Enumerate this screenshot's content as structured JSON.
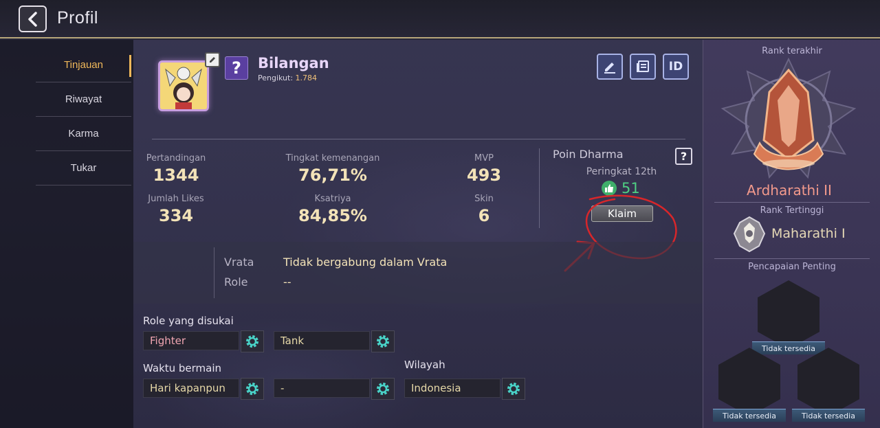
{
  "header": {
    "title": "Profil",
    "back_icon": "chevron-left-icon"
  },
  "nav": {
    "items": [
      "Tinjauan",
      "Riwayat",
      "Karma",
      "Tukar"
    ],
    "active": "Tinjauan"
  },
  "profile": {
    "username": "Bilangan",
    "followers_label": "Pengikut:",
    "followers_value": "1.784",
    "badge": "?",
    "actions": [
      "edit-icon",
      "news-icon",
      "id-icon"
    ],
    "id_label": "ID"
  },
  "stats": {
    "matches_label": "Pertandingan",
    "matches_value": "1344",
    "winrate_label": "Tingkat kemenangan",
    "winrate_value": "76,71%",
    "mvp_label": "MVP",
    "mvp_value": "493",
    "likes_label": "Jumlah Likes",
    "likes_value": "334",
    "knight_label": "Ksatriya",
    "knight_value": "84,85%",
    "skin_label": "Skin",
    "skin_value": "6"
  },
  "dharma": {
    "title": "Poin Dharma",
    "help": "?",
    "rank_position": "Peringkat 12th",
    "likes": "51",
    "claim_label": "Klaim"
  },
  "squad": {
    "vrata_label": "Vrata",
    "vrata_value": "Tidak bergabung dalam Vrata",
    "role_label": "Role",
    "role_value": "--"
  },
  "preferences": {
    "roles_title": "Role yang disukai",
    "role1": "Fighter",
    "role2": "Tank",
    "time_title": "Waktu bermain",
    "time1": "Hari kapanpun",
    "time2": "-",
    "region_title": "Wilayah",
    "region": "Indonesia"
  },
  "rank_panel": {
    "last_rank_title": "Rank terakhir",
    "last_rank": "Ardharathi II",
    "highest_title": "Rank Tertinggi",
    "highest_rank": "Maharathi I",
    "achievements_title": "Pencapaian Penting",
    "achievement_labels": [
      "Tidak tersedia",
      "Tidak tersedia",
      "Tidak tersedia"
    ]
  },
  "colors": {
    "accent_gold": "#f0b85a",
    "value_text": "#f3e3b8",
    "rank_pink": "#f39a8c",
    "like_green": "#4fcf83",
    "annotation_red": "#d8262a"
  }
}
